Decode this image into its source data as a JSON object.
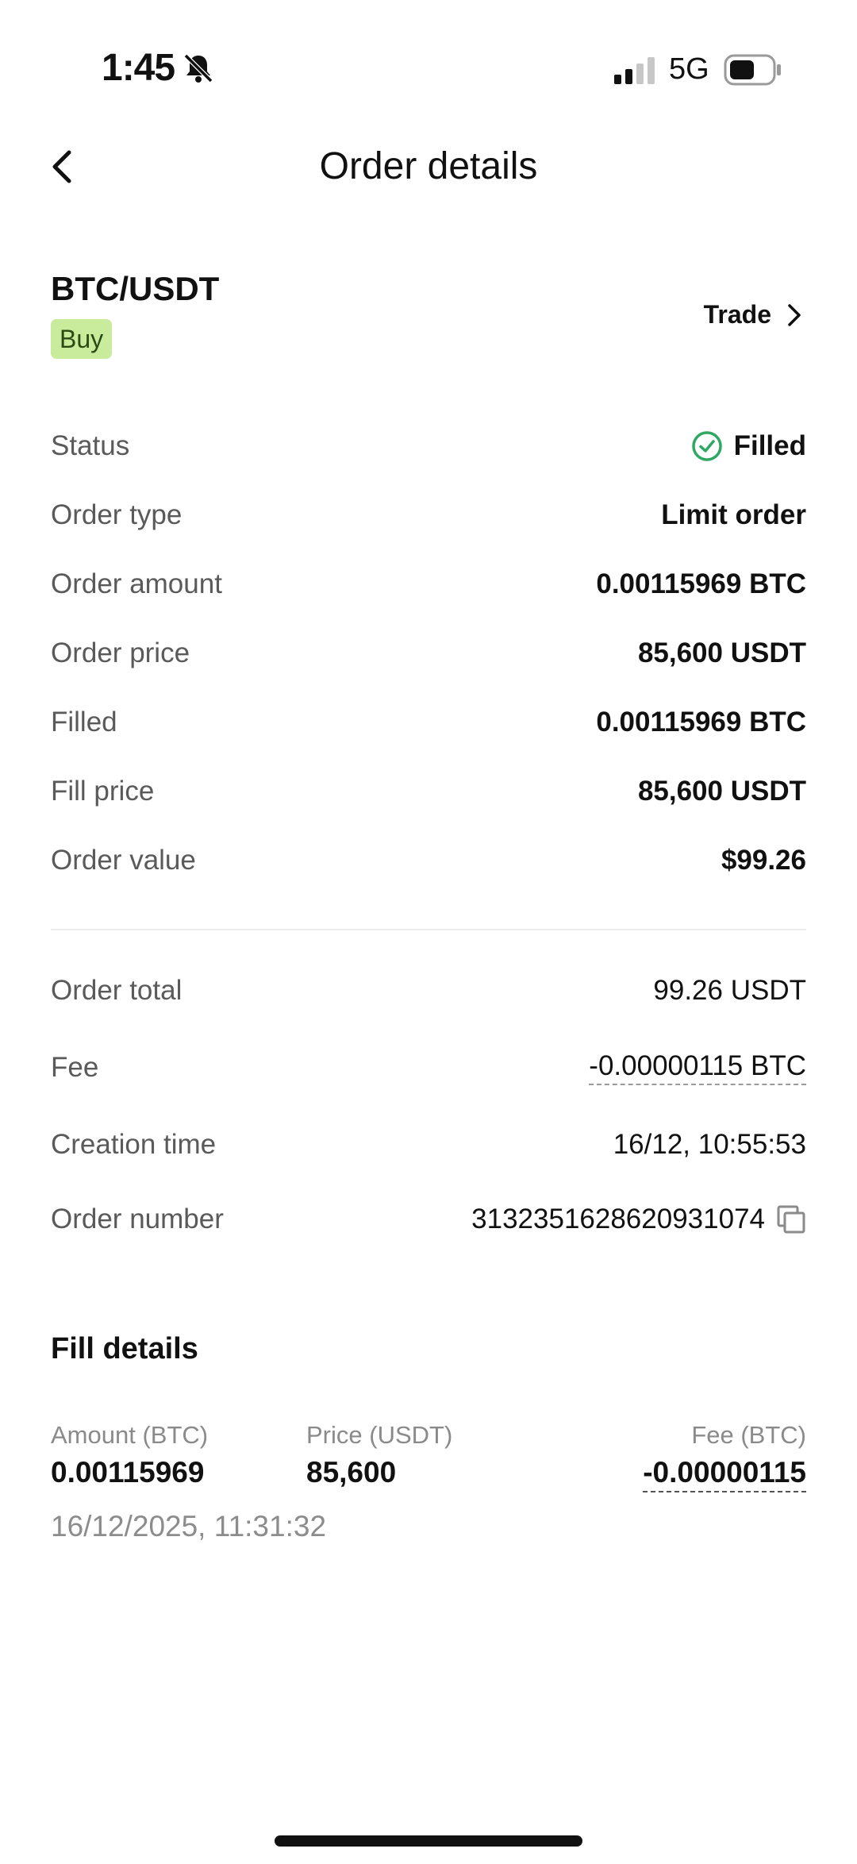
{
  "status_bar": {
    "time": "1:45",
    "network": "5G",
    "signal_icon": "cellular-signal-icon",
    "bell_icon": "bell-slash-icon",
    "battery_icon": "battery-icon"
  },
  "header": {
    "title": "Order details",
    "back_icon": "chevron-left-icon"
  },
  "order": {
    "pair": "BTC/USDT",
    "side": "Buy",
    "trade_link": "Trade"
  },
  "details": {
    "status_label": "Status",
    "status_value": "Filled",
    "order_type_label": "Order type",
    "order_type_value": "Limit order",
    "order_amount_label": "Order amount",
    "order_amount_value": "0.00115969 BTC",
    "order_price_label": "Order price",
    "order_price_value": "85,600 USDT",
    "filled_label": "Filled",
    "filled_value": "0.00115969 BTC",
    "fill_price_label": "Fill price",
    "fill_price_value": "85,600 USDT",
    "order_value_label": "Order value",
    "order_value_value": "$99.26",
    "order_total_label": "Order total",
    "order_total_value": "99.26 USDT",
    "fee_label": "Fee",
    "fee_value": "-0.00000115 BTC",
    "creation_time_label": "Creation time",
    "creation_time_value": "16/12, 10:55:53",
    "order_number_label": "Order number",
    "order_number_value": "3132351628620931074"
  },
  "fill_details": {
    "title": "Fill details",
    "amount_label": "Amount (BTC)",
    "amount_value": "0.00115969",
    "price_label": "Price (USDT)",
    "price_value": "85,600",
    "fee_label": "Fee (BTC)",
    "fee_value": "-0.00000115",
    "timestamp": "16/12/2025, 11:31:32"
  },
  "colors": {
    "accent_green": "#2ea862",
    "badge_bg": "#c9ec9c",
    "badge_text": "#2c4a12"
  }
}
